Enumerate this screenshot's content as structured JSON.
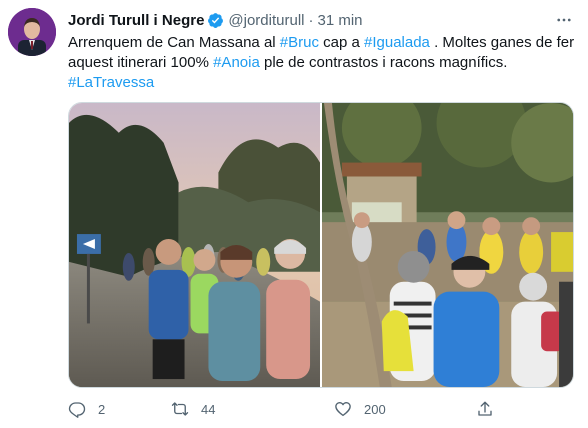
{
  "tweet": {
    "author_name": "Jordi Turull i Negre",
    "handle": "@jorditurull",
    "separator": "·",
    "time": "31 min",
    "text": {
      "part1": "Arrenquem de Can Massana al ",
      "tag1": "#Bruc",
      "part2": " cap a ",
      "tag2": "#Igualada",
      "part3": " . Moltes ganes de fer aquest itinerari 100% ",
      "tag3": "#Anoia",
      "part4": " ple de contrastos  i racons magnífics.",
      "tag4": "#LaTravessa"
    },
    "accent_color": "#1d9bf0"
  },
  "actions": {
    "reply_icon": "reply-icon",
    "reply_count": "2",
    "retweet_icon": "retweet-icon",
    "retweet_count": "44",
    "like_icon": "heart-icon",
    "like_count": "200",
    "share_icon": "share-icon"
  }
}
